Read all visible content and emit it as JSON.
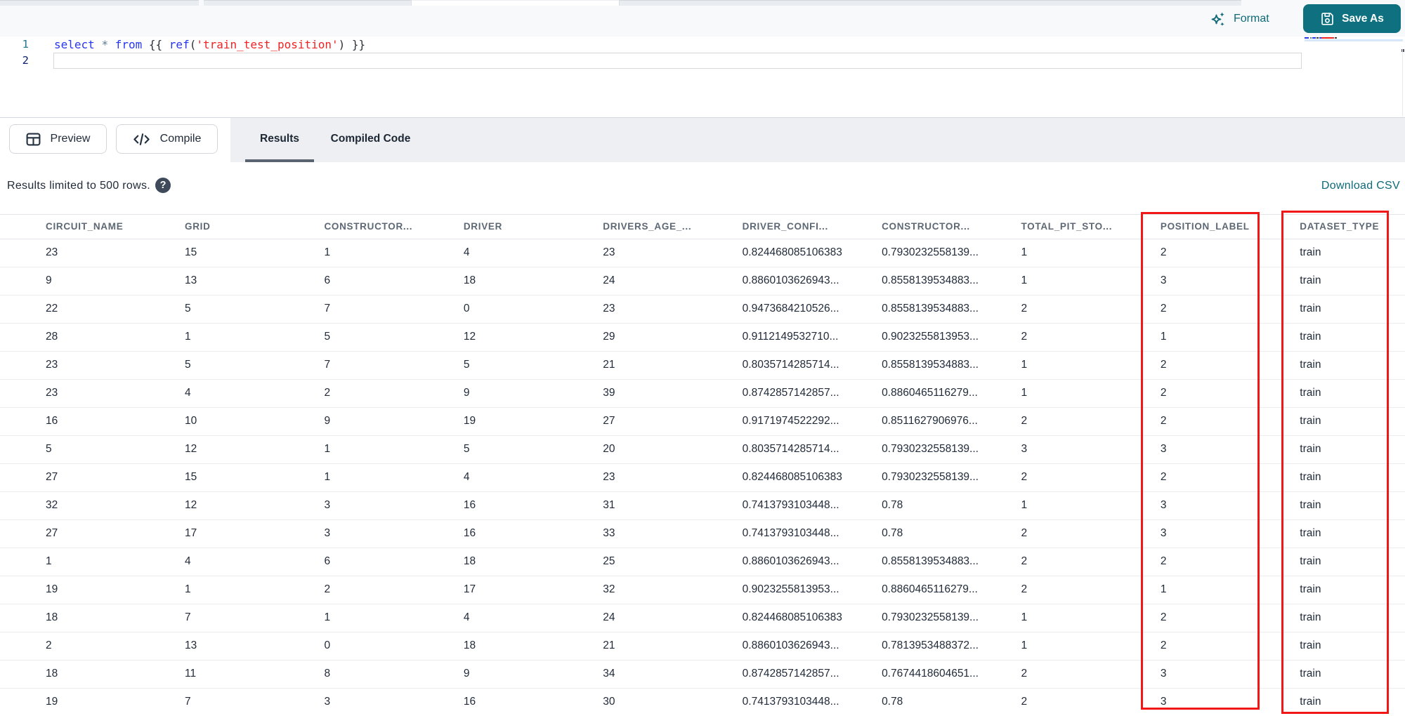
{
  "theme": {
    "teal_ink": "#0d6a78",
    "teal_btn": "#0f7180",
    "ink": "#212b3a",
    "annotation_red": "#f11717",
    "code_keyword": "#2637f0",
    "code_operator": "#5e7c93",
    "code_bracket": "#2d3238",
    "code_string": "#f02323"
  },
  "toolbar": {
    "format_label": "Format",
    "save_as_label": "Save As"
  },
  "editor": {
    "lines": [
      {
        "number": "1",
        "tokens": [
          {
            "text": "select",
            "type": "keyword"
          },
          {
            "text": " ",
            "type": "plain"
          },
          {
            "text": "*",
            "type": "operator"
          },
          {
            "text": " ",
            "type": "plain"
          },
          {
            "text": "from",
            "type": "keyword"
          },
          {
            "text": " ",
            "type": "plain"
          },
          {
            "text": "{{ ",
            "type": "bracket"
          },
          {
            "text": "ref",
            "type": "keyword"
          },
          {
            "text": "(",
            "type": "bracket"
          },
          {
            "text": "'train_test_position'",
            "type": "string"
          },
          {
            "text": ")",
            "type": "bracket"
          },
          {
            "text": " ",
            "type": "plain"
          },
          {
            "text": "}}",
            "type": "bracket"
          }
        ]
      },
      {
        "number": "2",
        "tokens": []
      }
    ],
    "minimap_segments": [
      {
        "w": 6,
        "c": "#2637f0"
      },
      {
        "w": 2,
        "c": "transparent"
      },
      {
        "w": 2,
        "c": "#5e7c93"
      },
      {
        "w": 1,
        "c": "transparent"
      },
      {
        "w": 5,
        "c": "#2637f0"
      },
      {
        "w": 1,
        "c": "transparent"
      },
      {
        "w": 3,
        "c": "#3a3f45"
      },
      {
        "w": 1,
        "c": "transparent"
      },
      {
        "w": 3,
        "c": "#2637f0"
      },
      {
        "w": 18,
        "c": "#f02323"
      },
      {
        "w": 1,
        "c": "transparent"
      },
      {
        "w": 3,
        "c": "#3a3f45"
      }
    ]
  },
  "actions": {
    "preview_label": "Preview",
    "compile_label": "Compile"
  },
  "result_tabs": {
    "results_label": "Results",
    "compiled_label": "Compiled Code"
  },
  "meta": {
    "limit_text": "Results limited to 500 rows.",
    "help_glyph": "?",
    "download_label": "Download CSV"
  },
  "table": {
    "columns": [
      "CIRCUIT_NAME",
      "GRID",
      "CONSTRUCTOR...",
      "DRIVER",
      "DRIVERS_AGE_...",
      "DRIVER_CONFI...",
      "CONSTRUCTOR...",
      "TOTAL_PIT_STO...",
      "POSITION_LABEL",
      "DATASET_TYPE"
    ],
    "rows": [
      [
        "23",
        "15",
        "1",
        "4",
        "23",
        "0.824468085106383",
        "0.7930232558139...",
        "1",
        "2",
        "train"
      ],
      [
        "9",
        "13",
        "6",
        "18",
        "24",
        "0.8860103626943...",
        "0.8558139534883...",
        "1",
        "3",
        "train"
      ],
      [
        "22",
        "5",
        "7",
        "0",
        "23",
        "0.9473684210526...",
        "0.8558139534883...",
        "2",
        "2",
        "train"
      ],
      [
        "28",
        "1",
        "5",
        "12",
        "29",
        "0.9112149532710...",
        "0.9023255813953...",
        "2",
        "1",
        "train"
      ],
      [
        "23",
        "5",
        "7",
        "5",
        "21",
        "0.8035714285714...",
        "0.8558139534883...",
        "1",
        "2",
        "train"
      ],
      [
        "23",
        "4",
        "2",
        "9",
        "39",
        "0.8742857142857...",
        "0.8860465116279...",
        "1",
        "2",
        "train"
      ],
      [
        "16",
        "10",
        "9",
        "19",
        "27",
        "0.9171974522292...",
        "0.8511627906976...",
        "2",
        "2",
        "train"
      ],
      [
        "5",
        "12",
        "1",
        "5",
        "20",
        "0.8035714285714...",
        "0.7930232558139...",
        "3",
        "3",
        "train"
      ],
      [
        "27",
        "15",
        "1",
        "4",
        "23",
        "0.824468085106383",
        "0.7930232558139...",
        "2",
        "2",
        "train"
      ],
      [
        "32",
        "12",
        "3",
        "16",
        "31",
        "0.7413793103448...",
        "0.78",
        "1",
        "3",
        "train"
      ],
      [
        "27",
        "17",
        "3",
        "16",
        "33",
        "0.7413793103448...",
        "0.78",
        "2",
        "3",
        "train"
      ],
      [
        "1",
        "4",
        "6",
        "18",
        "25",
        "0.8860103626943...",
        "0.8558139534883...",
        "2",
        "2",
        "train"
      ],
      [
        "19",
        "1",
        "2",
        "17",
        "32",
        "0.9023255813953...",
        "0.8860465116279...",
        "2",
        "1",
        "train"
      ],
      [
        "18",
        "7",
        "1",
        "4",
        "24",
        "0.824468085106383",
        "0.7930232558139...",
        "1",
        "2",
        "train"
      ],
      [
        "2",
        "13",
        "0",
        "18",
        "21",
        "0.8860103626943...",
        "0.7813953488372...",
        "1",
        "2",
        "train"
      ],
      [
        "18",
        "11",
        "8",
        "9",
        "34",
        "0.8742857142857...",
        "0.7674418604651...",
        "2",
        "3",
        "train"
      ],
      [
        "19",
        "7",
        "3",
        "16",
        "30",
        "0.7413793103448...",
        "0.78",
        "2",
        "3",
        "train"
      ]
    ]
  },
  "annotations": {
    "boxes": [
      "position-label-column-highlight",
      "dataset-type-column-highlight"
    ]
  }
}
